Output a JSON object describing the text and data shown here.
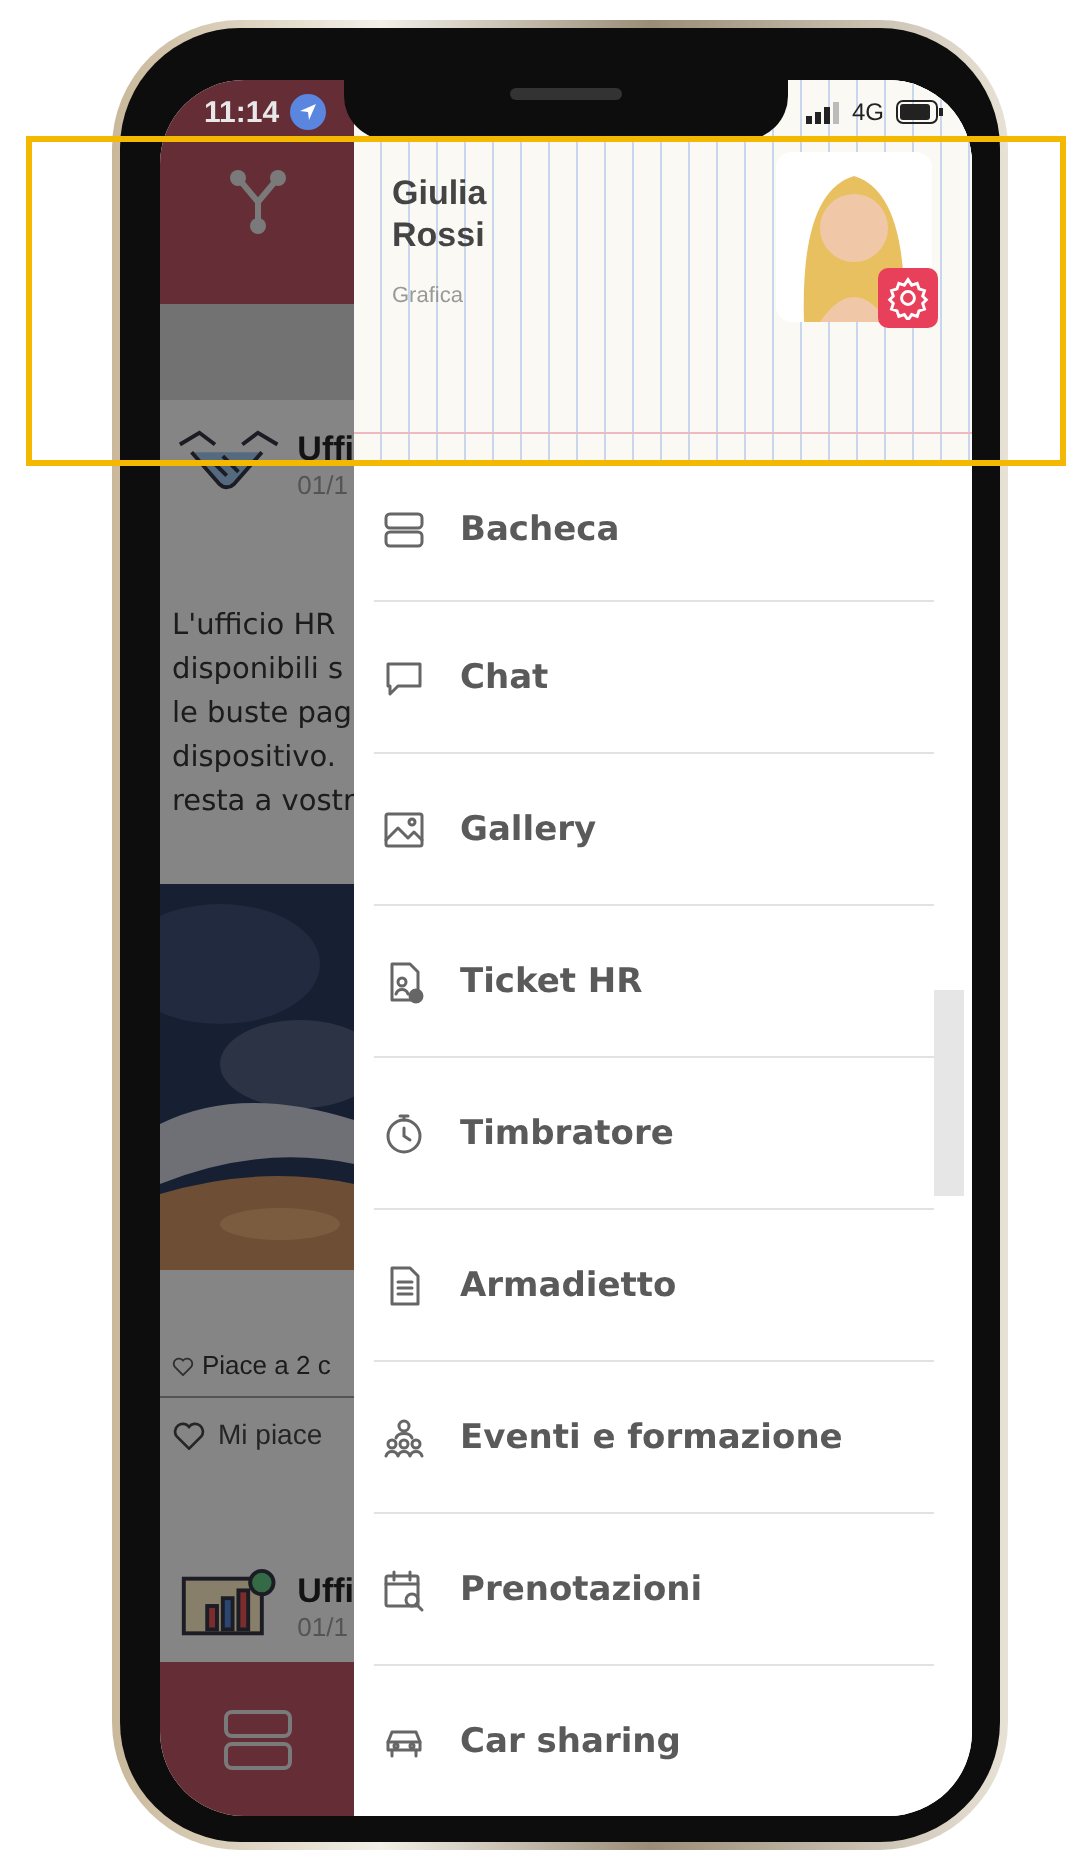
{
  "status_bar": {
    "time": "11:14",
    "network": "4G"
  },
  "background_app": {
    "post_1": {
      "title": "Uffi",
      "date": "01/1",
      "text_lines": [
        "L'ufficio HR",
        "disponibili s",
        "le buste pag",
        "dispositivo.",
        "resta a vostr"
      ]
    },
    "likes": "Piace a 2 c",
    "like_button": "Mi piace",
    "post_2": {
      "title": "Uffi",
      "date": "01/1"
    }
  },
  "drawer": {
    "profile": {
      "name": "Giulia Rossi",
      "role": "Grafica"
    },
    "menu": [
      {
        "label": "Bacheca",
        "kind": "board"
      },
      {
        "label": "Chat",
        "kind": "chat"
      },
      {
        "label": "Gallery",
        "kind": "gallery"
      },
      {
        "label": "Ticket HR",
        "kind": "ticket"
      },
      {
        "label": "Timbratore",
        "kind": "timer"
      },
      {
        "label": "Armadietto",
        "kind": "document"
      },
      {
        "label": "Eventi e formazione",
        "kind": "people"
      },
      {
        "label": "Prenotazioni",
        "kind": "calendar"
      },
      {
        "label": "Car sharing",
        "kind": "car"
      }
    ]
  }
}
